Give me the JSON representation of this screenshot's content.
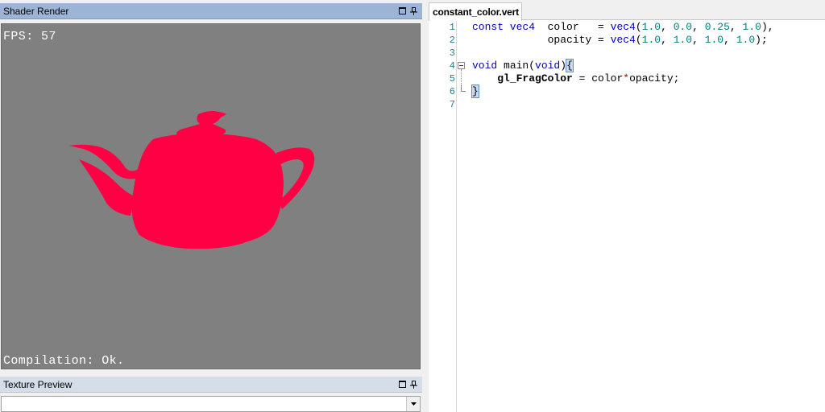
{
  "shader_panel": {
    "title": "Shader Render",
    "fps_text": "FPS: 57",
    "compile_text": "Compilation: Ok.",
    "teapot_color": "#ff0044",
    "background_color": "#808080"
  },
  "texture_panel": {
    "title": "Texture Preview",
    "selected_value": ""
  },
  "panel_buttons": {
    "restore_icon": "restore-window-icon",
    "pin_icon": "pin-icon"
  },
  "editor": {
    "tab_label": "constant_color.vert",
    "line_numbers": [
      "1",
      "2",
      "3",
      "4",
      "5",
      "6",
      "7"
    ],
    "lines": [
      {
        "l1a": "const vec4",
        "l1b": "  color   = ",
        "l1c": "vec4",
        "l1d": "(",
        "l1e": "1.0",
        "l1f": ", ",
        "l1g": "0.0",
        "l1h": ", ",
        "l1i": "0.25",
        "l1j": ", ",
        "l1k": "1.0",
        "l1l": "),"
      }
    ],
    "l2": {
      "a": "            opacity = ",
      "b": "vec4",
      "c": "(",
      "d": "1.0",
      "e": ", ",
      "f": "1.0",
      "g": ", ",
      "h": "1.0",
      "i": ", ",
      "j": "1.0",
      "k": ");"
    },
    "l4": {
      "a": "void",
      "b": " main(",
      "c": "void",
      "d": ")",
      "e": "{"
    },
    "l5": {
      "a": "    ",
      "b": "gl_FragColor",
      "c": " = color",
      "d": "*",
      "e": "opacity;"
    },
    "l6": {
      "a": "}"
    }
  }
}
